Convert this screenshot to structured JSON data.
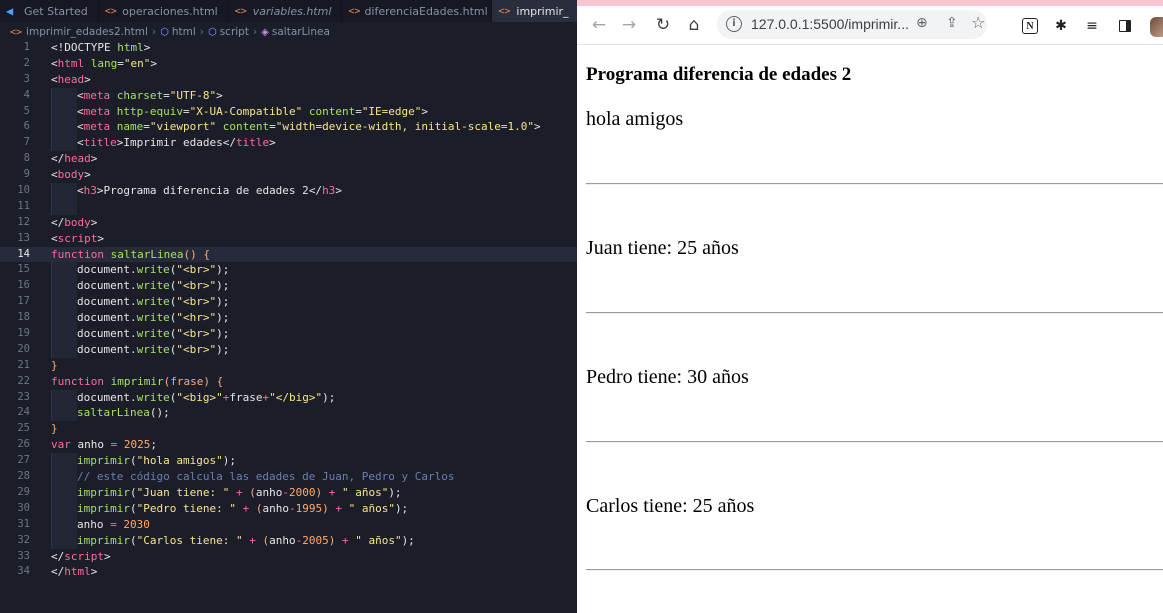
{
  "editor": {
    "tabs": [
      {
        "label": "Get Started",
        "icon": "vscode-icon"
      },
      {
        "label": "operaciones.html",
        "icon": "html-file-icon"
      },
      {
        "label": "variables.html",
        "icon": "html-file-icon"
      },
      {
        "label": "diferenciaEdades.html",
        "icon": "html-file-icon"
      },
      {
        "label": "imprimir_",
        "icon": "html-file-icon"
      }
    ],
    "breadcrumb": {
      "file": "imprimir_edades2.html",
      "html": "html",
      "script": "script",
      "function": "saltarLinea"
    },
    "current_line": 14,
    "line_numbers": [
      "1",
      "2",
      "3",
      "4",
      "5",
      "6",
      "7",
      "8",
      "9",
      "10",
      "11",
      "12",
      "13",
      "14",
      "15",
      "16",
      "17",
      "18",
      "19",
      "20",
      "21",
      "22",
      "23",
      "24",
      "25",
      "26",
      "27",
      "28",
      "29",
      "30",
      "31",
      "32",
      "33",
      "34"
    ],
    "code": {
      "l1_doctype": "<!DOCTYPE",
      "l1_html": "html",
      "l1_close": ">",
      "lang_attr": "lang",
      "lang_val": "\"en\"",
      "charset_attr": "charset",
      "charset_val": "\"UTF-8\"",
      "httpequiv_attr": "http-equiv",
      "httpequiv_val": "\"X-UA-Compatible\"",
      "content_attr": "content",
      "content_val1": "\"IE=edge\"",
      "name_attr": "name",
      "name_val": "\"viewport\"",
      "content_val2": "\"width=device-width, initial-scale=1.0\"",
      "title_text": "Imprimir edades",
      "h3_text": "Programa diferencia de edades 2",
      "kw_function": "function",
      "kw_var": "var",
      "fn_saltar": "saltarLinea",
      "fn_imprimir": "imprimir",
      "fn_write": "write",
      "doc": "document",
      "br": "\"<br>\"",
      "hr": "\"<hr>\"",
      "big_open": "\"<big>\"",
      "big_close": "\"</big>\"",
      "param": "frase",
      "var_anho": "anho",
      "n2025": "2025",
      "n2000": "2000",
      "n1995": "1995",
      "n2030": "2030",
      "n2005": "2005",
      "s_hola": "\"hola amigos\"",
      "comment": "// este código calcula las edades de Juan, Pedro y Carlos",
      "s_juan": "\"Juan tiene: \"",
      "s_pedro": "\"Pedro tiene: \"",
      "s_carlos": "\"Carlos tiene: \"",
      "s_anos": "\" años\""
    }
  },
  "browser": {
    "url": "127.0.0.1:5500/imprimir...",
    "page": {
      "heading": "Programa diferencia de edades 2",
      "lines": [
        "hola amigos",
        "Juan tiene: 25 años",
        "Pedro tiene: 30 años",
        "Carlos tiene: 25 años"
      ]
    },
    "toolbar_icons": [
      "back-arrow-icon",
      "forward-arrow-icon",
      "reload-icon",
      "home-icon",
      "site-info-icon",
      "zoom-icon",
      "share-icon",
      "bookmark-star-icon",
      "notion-icon",
      "extensions-icon",
      "media-control-icon",
      "side-panel-icon",
      "profile-avatar"
    ]
  }
}
